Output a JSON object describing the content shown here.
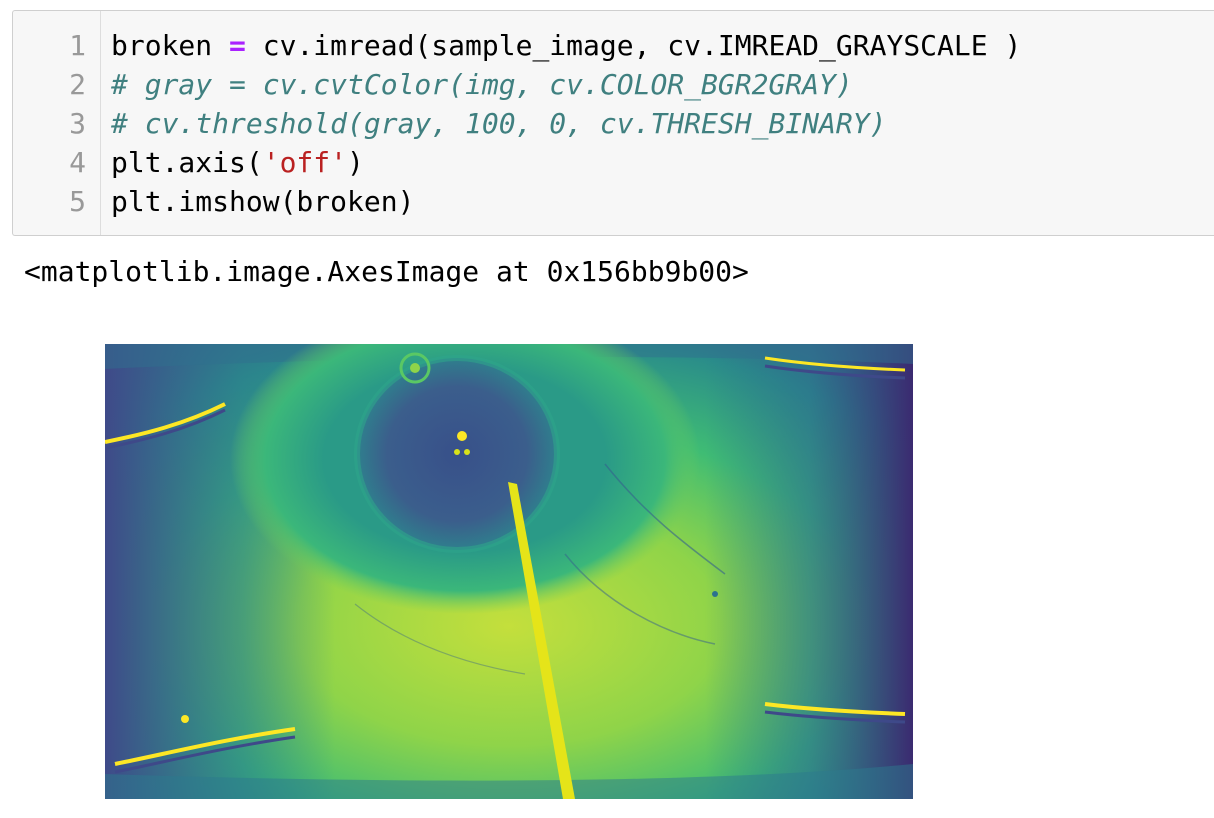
{
  "code_cell": {
    "line_numbers": [
      "1",
      "2",
      "3",
      "4",
      "5"
    ],
    "lines": {
      "l1": {
        "a": "broken ",
        "op": "=",
        "b": " cv.imread(sample_image, cv.IMREAD_GRAYSCALE )"
      },
      "l2": {
        "comment": "# gray = cv.cvtColor(img, cv.COLOR_BGR2GRAY)"
      },
      "l3": {
        "comment": "# cv.threshold(gray, 100, 0, cv.THRESH_BINARY)"
      },
      "l4": {
        "a": "plt.axis(",
        "str": "'off'",
        "b": ")"
      },
      "l5": {
        "a": "plt.imshow(broken)"
      }
    }
  },
  "output": {
    "text": "<matplotlib.image.AxesImage at 0x156bb9b00>"
  },
  "colors": {
    "cell_background": "#f7f7f7",
    "operator": "#aa22ff",
    "comment": "#408080",
    "string": "#ba2121",
    "line_number": "#999999",
    "colormap": "viridis"
  }
}
